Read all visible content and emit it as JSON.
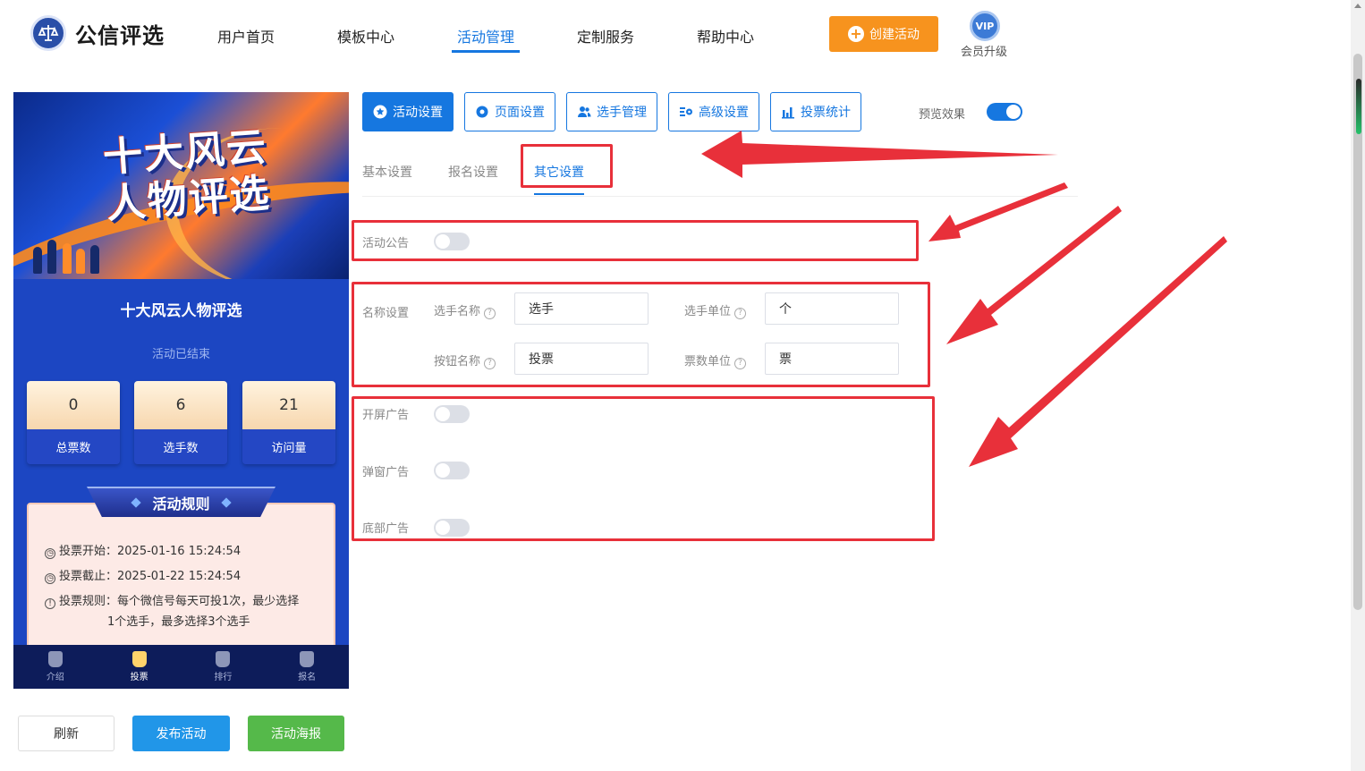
{
  "brand": {
    "name": "公信评选"
  },
  "nav": {
    "items": [
      "用户首页",
      "模板中心",
      "活动管理",
      "定制服务",
      "帮助中心"
    ],
    "active_index": 2
  },
  "create_button": "创建活动",
  "vip": {
    "badge": "VIP",
    "label": "会员升级"
  },
  "preview": {
    "banner_title_line1": "十大风云",
    "banner_title_line2": "人物评选",
    "title": "十大风云人物评选",
    "status": "活动已结束",
    "stats": [
      {
        "value": "0",
        "label": "总票数"
      },
      {
        "value": "6",
        "label": "选手数"
      },
      {
        "value": "21",
        "label": "访问量"
      }
    ],
    "rules_heading": "活动规则",
    "rules": [
      {
        "label": "投票开始：",
        "text": "2025-01-16 15:24:54"
      },
      {
        "label": "投票截止：",
        "text": "2025-01-22 15:24:54"
      },
      {
        "label": "投票规则：",
        "text": "每个微信号每天可投1次，最少选择",
        "text2": "1个选手，最多选择3个选手"
      }
    ],
    "tabbar": [
      "介绍",
      "投票",
      "排行",
      "报名"
    ],
    "tabbar_active": 1
  },
  "actions": {
    "refresh": "刷新",
    "publish": "发布活动",
    "poster": "活动海报"
  },
  "toolbar": {
    "items": [
      "活动设置",
      "页面设置",
      "选手管理",
      "高级设置",
      "投票统计"
    ],
    "active_index": 0,
    "preview_label": "预览效果",
    "preview_on": true
  },
  "subtabs": {
    "items": [
      "基本设置",
      "报名设置",
      "其它设置"
    ],
    "active_index": 2
  },
  "settings": {
    "announcement": {
      "label": "活动公告",
      "on": false
    },
    "naming": {
      "label": "名称设置",
      "player_name_label": "选手名称",
      "player_name_value": "选手",
      "player_unit_label": "选手单位",
      "player_unit_value": "个",
      "button_name_label": "按钮名称",
      "button_name_value": "投票",
      "vote_unit_label": "票数单位",
      "vote_unit_value": "票"
    },
    "ads": [
      {
        "label": "开屏广告",
        "on": false
      },
      {
        "label": "弹窗广告",
        "on": false
      },
      {
        "label": "底部广告",
        "on": false
      }
    ]
  },
  "colors": {
    "accent": "#1677e0",
    "annotation": "#e8303a",
    "create": "#f7931e",
    "poster": "#55b94a"
  }
}
